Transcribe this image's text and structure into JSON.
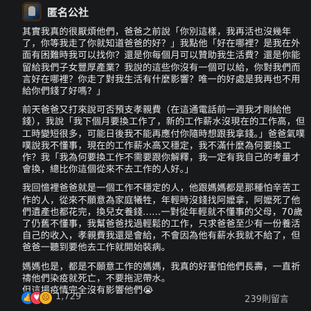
{
  "header": {
    "page_name": "匿名公社",
    "avatar_icon": "page-avatar"
  },
  "post": {
    "paragraphs": [
      "其實我真的很厭煩他們，爸爸之前說「你別這樣，我再活也沒幾年了，你等我走了你就知道爸爸的好？」我點他「好在哪裡？是我在外面有困難時我可以找你？還是你每個月可以贊助我生活費？還是你能留給我們子女豐厚產業？我說的這些你沒有一個可以給，你對我們而言好在哪裡？你走了對我生活有什麼影響？唯一的好處是我再也不用給你們錢了好嗎？」",
      "前天爸爸又打來說可否預支孝親費（在這通電話前一週我才剛給他錢），我說「我下個月要換工作了，新的工作薪水沒現在的工作高，但工時變短很多，可能日後我不能再應付你隨時想跟我拿錢。」爸爸氣噗噗說我不懂事，現在的工作薪水高又穩定，我不滿什麼為何要換工作？我「我為何要換工作不需要跟你解釋，我一定有我自己的考量才會換，總比你這個從來不去工作的人好。」",
      "我回憶裡爸爸就是一個工作不穩定的人，他跟媽媽都是那種怕辛苦工作的人，從來不願意為家庭犧牲，年輕時沒錢找阿嬤拿，阿嬤死了他們遺產也都花完，換兒女養錢......一對從年輕就不懂事的父母，70歲了仍舊不懂事，我幫爸爸找過輕鬆的工作，只求爸爸至少有一份養活自己的收入，孝親費我還是會給，不會因為他有薪水我就不給了，但爸爸一聽到要他去工作就開始裝病。",
      "媽媽也是，都是不願意工作的媽媽，我真的好害怕他們長壽，一直祈禱他們染疫就死亡，不要拖泥帶水。\n但這場疫情完全沒有影響他們😭"
    ]
  },
  "footer": {
    "reaction_count": "1,729",
    "comment_count": "239則留言",
    "reaction_icons": [
      "like-icon",
      "love-icon",
      "haha-icon"
    ]
  },
  "colors": {
    "background": "#18191a",
    "text": "#e4e6eb",
    "secondary_text": "#b0b3b8",
    "like_blue": "#1877f2",
    "love_red": "#f33e58",
    "haha_yellow": "#f7b125"
  }
}
